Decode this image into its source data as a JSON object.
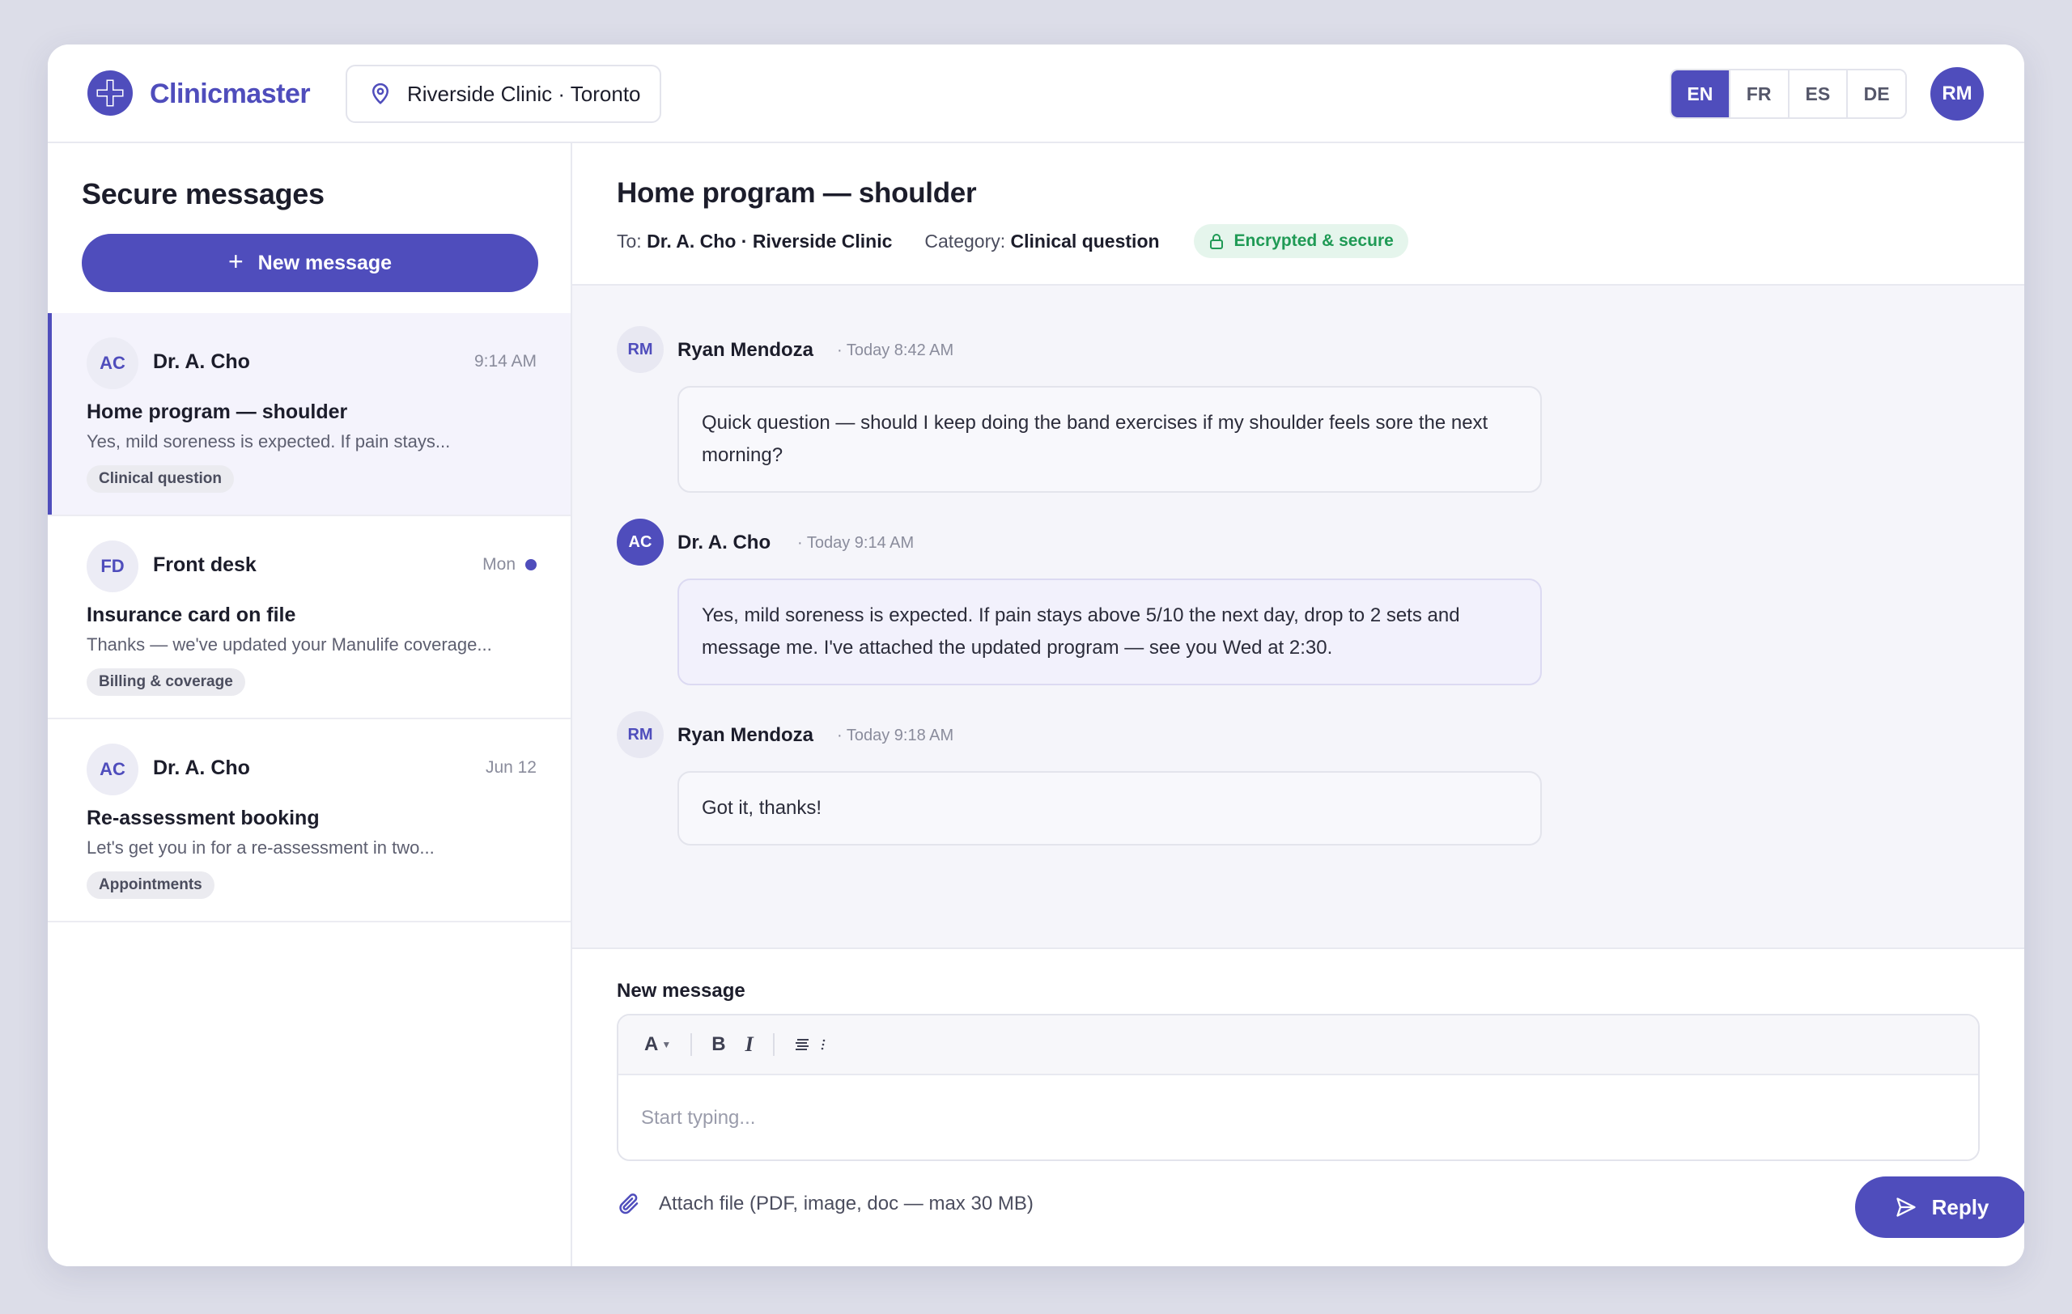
{
  "app": {
    "brand": "Clinicmaster",
    "location": "Riverside Clinic · Toronto"
  },
  "languages": [
    {
      "code": "EN",
      "active": true
    },
    {
      "code": "FR",
      "active": false
    },
    {
      "code": "ES",
      "active": false
    },
    {
      "code": "DE",
      "active": false
    }
  ],
  "user": {
    "initials": "RM"
  },
  "sidebar": {
    "title": "Secure messages",
    "new_message_label": "New message",
    "threads": [
      {
        "initials": "AC",
        "sender": "Dr. A. Cho",
        "time": "9:14 AM",
        "subject": "Home program — shoulder",
        "preview": "Yes, mild soreness is expected. If pain stays...",
        "tag": "Clinical question",
        "active": true,
        "unread": false
      },
      {
        "initials": "FD",
        "sender": "Front desk",
        "time": "Mon",
        "subject": "Insurance card on file",
        "preview": "Thanks — we've updated your Manulife coverage...",
        "tag": "Billing & coverage",
        "active": false,
        "unread": true
      },
      {
        "initials": "AC",
        "sender": "Dr. A. Cho",
        "time": "Jun 12",
        "subject": "Re-assessment booking",
        "preview": "Let's get you in for a re-assessment in two...",
        "tag": "Appointments",
        "active": false,
        "unread": false
      }
    ]
  },
  "conversation": {
    "title": "Home program — shoulder",
    "to_label": "To:",
    "to_value": "Dr. A. Cho · Riverside Clinic",
    "category_label": "Category:",
    "category_value": "Clinical question",
    "secure_badge": "Encrypted & secure",
    "messages": [
      {
        "initials": "RM",
        "sender": "Ryan Mendoza",
        "time": "· Today 8:42 AM",
        "role": "patient",
        "text": "Quick question — should I keep doing the band exercises if my shoulder feels sore the next morning?"
      },
      {
        "initials": "AC",
        "sender": "Dr. A. Cho",
        "time": "· Today 9:14 AM",
        "role": "doctor",
        "text": "Yes, mild soreness is expected. If pain stays above 5/10 the next day, drop to 2 sets and message me. I've attached the updated program — see you Wed at 2:30."
      },
      {
        "initials": "RM",
        "sender": "Ryan Mendoza",
        "time": "· Today 9:18 AM",
        "role": "patient",
        "text": "Got it, thanks!"
      }
    ]
  },
  "composer": {
    "label": "New message",
    "toolbar": {
      "font": "A",
      "bold": "B",
      "italic": "I"
    },
    "placeholder": "Start typing...",
    "attach_label": "Attach file (PDF, image, doc — max 30 MB)",
    "reply_label": "Reply"
  },
  "colors": {
    "accent": "#4f4dbc",
    "secure": "#1f9a55",
    "secure_bg": "#e5f5ec"
  },
  "icons": {
    "logo": "medical-cross-logo",
    "location": "map-pin-icon",
    "lock": "lock-icon",
    "attach": "paperclip-icon",
    "send": "send-icon",
    "plus": "plus-icon"
  }
}
